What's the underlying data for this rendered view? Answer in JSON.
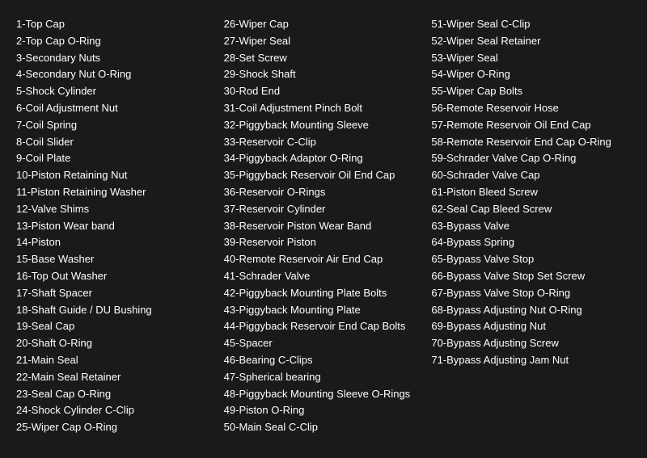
{
  "columns": [
    {
      "id": "col1",
      "items": [
        "1-Top Cap",
        "2-Top Cap O-Ring",
        "3-Secondary Nuts",
        "4-Secondary Nut O-Ring",
        "5-Shock Cylinder",
        "6-Coil Adjustment Nut",
        "7-Coil Spring",
        "8-Coil Slider",
        "9-Coil Plate",
        "10-Piston Retaining Nut",
        "11-Piston Retaining Washer",
        "12-Valve Shims",
        "13-Piston Wear band",
        "14-Piston",
        "15-Base Washer",
        "16-Top Out Washer",
        "17-Shaft Spacer",
        "18-Shaft Guide / DU Bushing",
        "19-Seal Cap",
        "20-Shaft O-Ring",
        "21-Main Seal",
        "22-Main Seal Retainer",
        "23-Seal Cap O-Ring",
        "24-Shock Cylinder C-Clip",
        "25-Wiper Cap O-Ring"
      ]
    },
    {
      "id": "col2",
      "items": [
        "26-Wiper Cap",
        "27-Wiper Seal",
        "28-Set Screw",
        "29-Shock Shaft",
        "30-Rod End",
        "31-Coil Adjustment Pinch Bolt",
        "32-Piggyback Mounting Sleeve",
        "33-Reservoir C-Clip",
        "34-Piggyback Adaptor O-Ring",
        "35-Piggyback Reservoir Oil End Cap",
        "36-Reservoir O-Rings",
        "37-Reservoir Cylinder",
        "38-Reservoir Piston Wear Band",
        "39-Reservoir Piston",
        "40-Remote Reservoir Air End Cap",
        "41-Schrader Valve",
        "42-Piggyback Mounting Plate Bolts",
        "43-Piggyback Mounting Plate",
        "44-Piggyback Reservoir End Cap Bolts",
        "45-Spacer",
        "46-Bearing C-Clips",
        "47-Spherical bearing",
        "48-Piggyback Mounting Sleeve O-Rings",
        "49-Piston O-Ring",
        "50-Main Seal C-Clip"
      ]
    },
    {
      "id": "col3",
      "items": [
        "51-Wiper Seal C-Clip",
        "52-Wiper Seal Retainer",
        "53-Wiper Seal",
        "54-Wiper O-Ring",
        "55-Wiper Cap Bolts",
        "56-Remote Reservoir Hose",
        "57-Remote Reservoir Oil End Cap",
        "58-Remote Reservoir End Cap O-Ring",
        "59-Schrader Valve Cap O-Ring",
        "60-Schrader Valve Cap",
        "61-Piston Bleed Screw",
        "62-Seal Cap Bleed Screw",
        "63-Bypass Valve",
        "64-Bypass Spring",
        "65-Bypass Valve Stop",
        "66-Bypass Valve Stop Set Screw",
        "67-Bypass Valve Stop O-Ring",
        "68-Bypass Adjusting Nut O-Ring",
        "69-Bypass Adjusting Nut",
        "70-Bypass Adjusting Screw",
        "71-Bypass Adjusting Jam Nut"
      ]
    }
  ]
}
